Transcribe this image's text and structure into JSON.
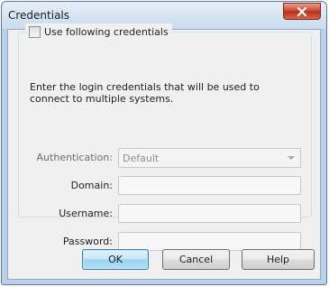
{
  "window": {
    "title": "Credentials",
    "close_icon": "close-icon"
  },
  "credentials_group": {
    "checkbox_label": "Use following credentials",
    "checkbox_checked": false,
    "description": "Enter the login credentials that will be used to connect to multiple systems."
  },
  "fields": {
    "authentication": {
      "label": "Authentication:",
      "value": "Default"
    },
    "domain": {
      "label": "Domain:",
      "value": ""
    },
    "username": {
      "label": "Username:",
      "value": ""
    },
    "password": {
      "label": "Password:",
      "value": ""
    }
  },
  "buttons": {
    "ok": "OK",
    "cancel": "Cancel",
    "help": "Help"
  },
  "colors": {
    "close_button": "#c7412b",
    "default_button_border": "#3c7fb1",
    "window_frame": "#b9d1ea"
  }
}
